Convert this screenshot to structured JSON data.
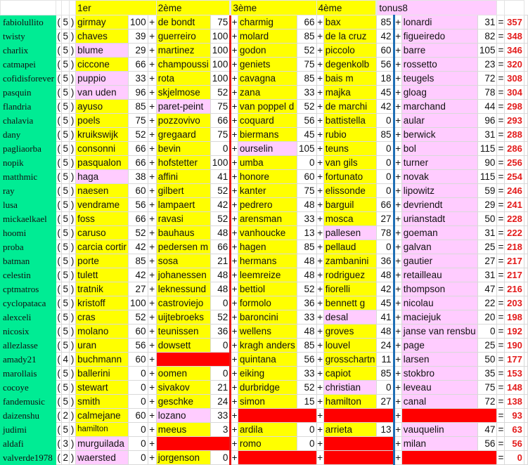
{
  "colors": {
    "name_bg": "#00ec94",
    "yellow": "#ffff00",
    "pink": "#ffccff",
    "red": "#ff0000",
    "total_text": "#e31b1b",
    "divider_red": "#e41a1a",
    "divider_blue": "#1f6fb5"
  },
  "header": {
    "col1": "1er",
    "col2": "2ème",
    "col3": "3ème",
    "col4": "4ème",
    "col5": "tonus8"
  },
  "symbols": {
    "open": "(",
    "close": ")",
    "plus": "+",
    "equals": "="
  },
  "rows": [
    {
      "name": "fabiolullito",
      "count": "5",
      "picks": [
        {
          "rider": "girmay",
          "score": "100",
          "fill": "Y"
        },
        {
          "rider": "de bondt",
          "score": "75",
          "fill": "Y"
        },
        {
          "rider": "charmig",
          "score": "66",
          "fill": "Y"
        },
        {
          "rider": "bax",
          "score": "85",
          "fill": "Y"
        },
        {
          "rider": "lonardi",
          "score": "31",
          "fill": "P"
        }
      ],
      "total": "357"
    },
    {
      "name": "twisty",
      "count": "5",
      "picks": [
        {
          "rider": "chaves",
          "score": "39",
          "fill": "Y"
        },
        {
          "rider": "guerreiro",
          "score": "100",
          "fill": "Y"
        },
        {
          "rider": "molard",
          "score": "85",
          "fill": "Y"
        },
        {
          "rider": "de la cruz",
          "score": "42",
          "fill": "Y"
        },
        {
          "rider": "figueiredo",
          "score": "82",
          "fill": "P"
        }
      ],
      "total": "348"
    },
    {
      "name": "charlix",
      "count": "5",
      "picks": [
        {
          "rider": "blume",
          "score": "29",
          "fill": "P"
        },
        {
          "rider": "martinez",
          "score": "100",
          "fill": "Y"
        },
        {
          "rider": "godon",
          "score": "52",
          "fill": "Y"
        },
        {
          "rider": "piccolo",
          "score": "60",
          "fill": "Y"
        },
        {
          "rider": "barre",
          "score": "105",
          "fill": "P"
        }
      ],
      "total": "346"
    },
    {
      "name": "catmapei",
      "count": "5",
      "picks": [
        {
          "rider": "ciccone",
          "score": "66",
          "fill": "Y"
        },
        {
          "rider": "champoussi",
          "score": "100",
          "fill": "Y"
        },
        {
          "rider": "geniets",
          "score": "75",
          "fill": "Y"
        },
        {
          "rider": "degenkolb",
          "score": "56",
          "fill": "Y"
        },
        {
          "rider": "rossetto",
          "score": "23",
          "fill": "P"
        }
      ],
      "total": "320"
    },
    {
      "name": "cofidisforever",
      "count": "5",
      "picks": [
        {
          "rider": "puppio",
          "score": "33",
          "fill": "P"
        },
        {
          "rider": "rota",
          "score": "100",
          "fill": "Y"
        },
        {
          "rider": "cavagna",
          "score": "85",
          "fill": "Y"
        },
        {
          "rider": "bais m",
          "score": "18",
          "fill": "Y"
        },
        {
          "rider": "teugels",
          "score": "72",
          "fill": "P"
        }
      ],
      "total": "308"
    },
    {
      "name": "pasquin",
      "count": "5",
      "picks": [
        {
          "rider": "van uden",
          "score": "96",
          "fill": "P"
        },
        {
          "rider": "skjelmose",
          "score": "52",
          "fill": "Y"
        },
        {
          "rider": "zana",
          "score": "33",
          "fill": "Y"
        },
        {
          "rider": "majka",
          "score": "45",
          "fill": "Y"
        },
        {
          "rider": "gloag",
          "score": "78",
          "fill": "P"
        }
      ],
      "total": "304"
    },
    {
      "name": "flandria",
      "count": "5",
      "picks": [
        {
          "rider": "ayuso",
          "score": "85",
          "fill": "Y"
        },
        {
          "rider": "paret-peint",
          "score": "75",
          "fill": "P"
        },
        {
          "rider": "van poppel d",
          "score": "52",
          "fill": "Y"
        },
        {
          "rider": "de marchi",
          "score": "42",
          "fill": "Y"
        },
        {
          "rider": "marchand",
          "score": "44",
          "fill": "P"
        }
      ],
      "total": "298"
    },
    {
      "name": "chalavia",
      "count": "5",
      "picks": [
        {
          "rider": "poels",
          "score": "75",
          "fill": "Y"
        },
        {
          "rider": "pozzovivo",
          "score": "66",
          "fill": "Y"
        },
        {
          "rider": "coquard",
          "score": "56",
          "fill": "Y"
        },
        {
          "rider": "battistella",
          "score": "0",
          "fill": "Y"
        },
        {
          "rider": "aular",
          "score": "96",
          "fill": "P"
        }
      ],
      "total": "293"
    },
    {
      "name": "dany",
      "count": "5",
      "picks": [
        {
          "rider": "kruikswijk",
          "score": "52",
          "fill": "Y"
        },
        {
          "rider": "gregaard",
          "score": "75",
          "fill": "Y"
        },
        {
          "rider": "biermans",
          "score": "45",
          "fill": "Y"
        },
        {
          "rider": "rubio",
          "score": "85",
          "fill": "Y"
        },
        {
          "rider": "berwick",
          "score": "31",
          "fill": "P"
        }
      ],
      "total": "288"
    },
    {
      "name": "pagliaorba",
      "count": "5",
      "picks": [
        {
          "rider": "consonni",
          "score": "66",
          "fill": "Y"
        },
        {
          "rider": "bevin",
          "score": "0",
          "fill": "Y"
        },
        {
          "rider": "ourselin",
          "score": "105",
          "fill": "P"
        },
        {
          "rider": "teuns",
          "score": "0",
          "fill": "Y"
        },
        {
          "rider": "bol",
          "score": "115",
          "fill": "P"
        }
      ],
      "total": "286"
    },
    {
      "name": "nopik",
      "count": "5",
      "picks": [
        {
          "rider": "pasqualon",
          "score": "66",
          "fill": "Y"
        },
        {
          "rider": "hofstetter",
          "score": "100",
          "fill": "Y"
        },
        {
          "rider": "umba",
          "score": "0",
          "fill": "Y"
        },
        {
          "rider": "van gils",
          "score": "0",
          "fill": "Y"
        },
        {
          "rider": "turner",
          "score": "90",
          "fill": "P"
        }
      ],
      "total": "256"
    },
    {
      "name": "matthmic",
      "count": "5",
      "picks": [
        {
          "rider": "haga",
          "score": "38",
          "fill": "P"
        },
        {
          "rider": "affini",
          "score": "41",
          "fill": "Y"
        },
        {
          "rider": "honore",
          "score": "60",
          "fill": "Y"
        },
        {
          "rider": "fortunato",
          "score": "0",
          "fill": "Y"
        },
        {
          "rider": "novak",
          "score": "115",
          "fill": "P"
        }
      ],
      "total": "254"
    },
    {
      "name": "ray",
      "count": "5",
      "picks": [
        {
          "rider": "naesen",
          "score": "60",
          "fill": "Y"
        },
        {
          "rider": "gilbert",
          "score": "52",
          "fill": "Y"
        },
        {
          "rider": "kanter",
          "score": "75",
          "fill": "Y"
        },
        {
          "rider": "elissonde",
          "score": "0",
          "fill": "Y"
        },
        {
          "rider": "lipowitz",
          "score": "59",
          "fill": "P"
        }
      ],
      "total": "246"
    },
    {
      "name": "lusa",
      "count": "5",
      "picks": [
        {
          "rider": "vendrame",
          "score": "56",
          "fill": "Y"
        },
        {
          "rider": "lampaert",
          "score": "42",
          "fill": "Y"
        },
        {
          "rider": "pedrero",
          "score": "48",
          "fill": "Y"
        },
        {
          "rider": "barguil",
          "score": "66",
          "fill": "Y"
        },
        {
          "rider": "devriendt",
          "score": "29",
          "fill": "P"
        }
      ],
      "total": "241"
    },
    {
      "name": "mickaelkael",
      "count": "5",
      "picks": [
        {
          "rider": "foss",
          "score": "66",
          "fill": "Y"
        },
        {
          "rider": "ravasi",
          "score": "52",
          "fill": "Y"
        },
        {
          "rider": "arensman",
          "score": "33",
          "fill": "Y"
        },
        {
          "rider": "mosca",
          "score": "27",
          "fill": "Y"
        },
        {
          "rider": "urianstadt",
          "score": "50",
          "fill": "P"
        }
      ],
      "total": "228"
    },
    {
      "name": "hoomi",
      "count": "5",
      "picks": [
        {
          "rider": "caruso",
          "score": "52",
          "fill": "Y"
        },
        {
          "rider": "bauhaus",
          "score": "48",
          "fill": "Y"
        },
        {
          "rider": "vanhoucke",
          "score": "13",
          "fill": "Y"
        },
        {
          "rider": "pallesen",
          "score": "78",
          "fill": "P"
        },
        {
          "rider": "goeman",
          "score": "31",
          "fill": "P"
        }
      ],
      "total": "222"
    },
    {
      "name": "proba",
      "count": "5",
      "picks": [
        {
          "rider": "carcia cortir",
          "score": "42",
          "fill": "Y"
        },
        {
          "rider": "pedersen m",
          "score": "66",
          "fill": "Y"
        },
        {
          "rider": "hagen",
          "score": "85",
          "fill": "Y"
        },
        {
          "rider": "pellaud",
          "score": "0",
          "fill": "Y"
        },
        {
          "rider": "galvan",
          "score": "25",
          "fill": "P"
        }
      ],
      "total": "218"
    },
    {
      "name": "batman",
      "count": "5",
      "picks": [
        {
          "rider": "porte",
          "score": "85",
          "fill": "Y"
        },
        {
          "rider": "sosa",
          "score": "21",
          "fill": "Y"
        },
        {
          "rider": "hermans",
          "score": "48",
          "fill": "Y"
        },
        {
          "rider": "zambanini",
          "score": "36",
          "fill": "Y"
        },
        {
          "rider": "gautier",
          "score": "27",
          "fill": "P"
        }
      ],
      "total": "217"
    },
    {
      "name": "celestin",
      "count": "5",
      "picks": [
        {
          "rider": "tulett",
          "score": "42",
          "fill": "Y"
        },
        {
          "rider": "johanessen",
          "score": "48",
          "fill": "Y"
        },
        {
          "rider": "leemreize",
          "score": "48",
          "fill": "Y"
        },
        {
          "rider": "rodriguez",
          "score": "48",
          "fill": "Y"
        },
        {
          "rider": "retailleau",
          "score": "31",
          "fill": "P"
        }
      ],
      "total": "217"
    },
    {
      "name": "cptmatros",
      "count": "5",
      "picks": [
        {
          "rider": "tratnik",
          "score": "27",
          "fill": "Y"
        },
        {
          "rider": "leknessund",
          "score": "48",
          "fill": "Y"
        },
        {
          "rider": "bettiol",
          "score": "52",
          "fill": "Y"
        },
        {
          "rider": "fiorelli",
          "score": "42",
          "fill": "Y"
        },
        {
          "rider": "thompson",
          "score": "47",
          "fill": "P"
        }
      ],
      "total": "216"
    },
    {
      "name": "cyclopataca",
      "count": "5",
      "picks": [
        {
          "rider": "kristoff",
          "score": "100",
          "fill": "Y"
        },
        {
          "rider": "castroviejo",
          "score": "0",
          "fill": "Y"
        },
        {
          "rider": "formolo",
          "score": "36",
          "fill": "Y"
        },
        {
          "rider": "bennett g",
          "score": "45",
          "fill": "Y"
        },
        {
          "rider": "nicolau",
          "score": "22",
          "fill": "P"
        }
      ],
      "total": "203"
    },
    {
      "name": "alexceli",
      "count": "5",
      "picks": [
        {
          "rider": "cras",
          "score": "52",
          "fill": "Y"
        },
        {
          "rider": "uijtebroeks",
          "score": "52",
          "fill": "Y"
        },
        {
          "rider": "baroncini",
          "score": "33",
          "fill": "Y"
        },
        {
          "rider": "desal",
          "score": "41",
          "fill": "P"
        },
        {
          "rider": "maciejuk",
          "score": "20",
          "fill": "P"
        }
      ],
      "total": "198"
    },
    {
      "name": "nicosix",
      "count": "5",
      "picks": [
        {
          "rider": "molano",
          "score": "60",
          "fill": "Y"
        },
        {
          "rider": "teunissen",
          "score": "36",
          "fill": "Y"
        },
        {
          "rider": "wellens",
          "score": "48",
          "fill": "Y"
        },
        {
          "rider": "groves",
          "score": "48",
          "fill": "Y"
        },
        {
          "rider": "janse van rensbu",
          "score": "0",
          "fill": "P"
        }
      ],
      "total": "192"
    },
    {
      "name": "allezlasse",
      "count": "5",
      "picks": [
        {
          "rider": "uran",
          "score": "56",
          "fill": "Y"
        },
        {
          "rider": "dowsett",
          "score": "0",
          "fill": "Y"
        },
        {
          "rider": "kragh anders",
          "score": "85",
          "fill": "Y"
        },
        {
          "rider": "louvel",
          "score": "24",
          "fill": "Y"
        },
        {
          "rider": "page",
          "score": "25",
          "fill": "P"
        }
      ],
      "total": "190"
    },
    {
      "name": "amady21",
      "count": "4",
      "picks": [
        {
          "rider": "buchmann",
          "score": "60",
          "fill": "Y"
        },
        {
          "fill": "red"
        },
        {
          "rider": "quintana",
          "score": "56",
          "fill": "Y"
        },
        {
          "rider": "grosschartn",
          "score": "11",
          "fill": "Y"
        },
        {
          "rider": "larsen",
          "score": "50",
          "fill": "P"
        }
      ],
      "total": "177"
    },
    {
      "name": "marollais",
      "count": "5",
      "picks": [
        {
          "rider": "ballerini",
          "score": "0",
          "fill": "Y"
        },
        {
          "rider": "oomen",
          "score": "0",
          "fill": "Y"
        },
        {
          "rider": "eiking",
          "score": "33",
          "fill": "Y"
        },
        {
          "rider": "capiot",
          "score": "85",
          "fill": "Y"
        },
        {
          "rider": "stokbro",
          "score": "35",
          "fill": "P"
        }
      ],
      "total": "153"
    },
    {
      "name": "cocoye",
      "count": "5",
      "picks": [
        {
          "rider": "stewart",
          "score": "0",
          "fill": "Y"
        },
        {
          "rider": "sivakov",
          "score": "21",
          "fill": "Y"
        },
        {
          "rider": "durbridge",
          "score": "52",
          "fill": "Y"
        },
        {
          "rider": "christian",
          "score": "0",
          "fill": "P"
        },
        {
          "rider": "leveau",
          "score": "75",
          "fill": "P"
        }
      ],
      "total": "148"
    },
    {
      "name": "fandemusic",
      "count": "5",
      "picks": [
        {
          "rider": "smith",
          "score": "0",
          "fill": "Y"
        },
        {
          "rider": "geschke",
          "score": "24",
          "fill": "Y"
        },
        {
          "rider": "simon",
          "score": "15",
          "fill": "Y"
        },
        {
          "rider": "hamilton",
          "score": "27",
          "fill": "Y"
        },
        {
          "rider": "canal",
          "score": "72",
          "fill": "P"
        }
      ],
      "total": "138"
    },
    {
      "name": "daizenshu",
      "count": "2",
      "picks": [
        {
          "rider": "calmejane",
          "score": "60",
          "fill": "Y"
        },
        {
          "rider": "lozano",
          "score": "33",
          "fill": "P"
        },
        {
          "fill": "red"
        },
        {
          "fill": "red"
        },
        {
          "fill": "red"
        }
      ],
      "total": "93"
    },
    {
      "name": "judimi",
      "count": "5",
      "picks": [
        {
          "rider": "hamilton",
          "score": "0",
          "fill": "Y"
        },
        {
          "rider": "meeus",
          "score": "3",
          "fill": "Y"
        },
        {
          "rider": "ardila",
          "score": "0",
          "fill": "Y"
        },
        {
          "rider": "arrieta",
          "score": "13",
          "fill": "Y"
        },
        {
          "rider": "vauquelin",
          "score": "47",
          "fill": "P"
        }
      ],
      "total": "63"
    },
    {
      "name": "aldafi",
      "count": "3",
      "picks": [
        {
          "rider": "murguilada",
          "score": "0",
          "fill": "P"
        },
        {
          "fill": "red"
        },
        {
          "rider": "romo",
          "score": "0",
          "fill": "Y"
        },
        {
          "fill": "red"
        },
        {
          "rider": "milan",
          "score": "56",
          "fill": "P"
        }
      ],
      "total": "56"
    },
    {
      "name": "valverde1978",
      "count": "2",
      "picks": [
        {
          "rider": "waersted",
          "score": "0",
          "fill": "P"
        },
        {
          "rider": "jorgenson",
          "score": "0",
          "fill": "Y"
        },
        {
          "fill": "red"
        },
        {
          "fill": "red"
        },
        {
          "fill": "red"
        }
      ],
      "total": "0"
    }
  ]
}
